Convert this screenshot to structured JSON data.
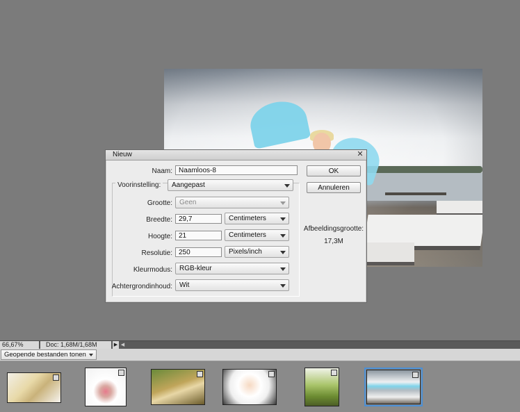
{
  "dialog": {
    "title": "Nieuw",
    "name_label": "Naam:",
    "name_value": "Naamloos-8",
    "preset_label": "Voorinstelling:",
    "preset_value": "Aangepast",
    "size_label": "Grootte:",
    "size_value": "Geen",
    "width_label": "Breedte:",
    "width_value": "29,7",
    "width_unit": "Centimeters",
    "height_label": "Hoogte:",
    "height_value": "21",
    "height_unit": "Centimeters",
    "resolution_label": "Resolutie:",
    "resolution_value": "250",
    "resolution_unit": "Pixels/inch",
    "colormode_label": "Kleurmodus:",
    "colormode_value": "RGB-kleur",
    "background_label": "Achtergrondinhoud:",
    "background_value": "Wit",
    "ok_label": "OK",
    "cancel_label": "Annuleren",
    "image_size_label": "Afbeeldingsgrootte:",
    "image_size_value": "17,3M"
  },
  "status": {
    "zoom": "66,67%",
    "doc": "Doc: 1,68M/1,68M"
  },
  "bin": {
    "dropdown_value": "Geopende bestanden tonen",
    "thumbnails": [
      "thumb-1",
      "thumb-2",
      "thumb-3",
      "thumb-4",
      "thumb-5",
      "thumb-6"
    ]
  },
  "colors": {
    "workspace": "#7b7b7b",
    "dialog_bg": "#ececec",
    "selection": "#4a8fd6"
  }
}
